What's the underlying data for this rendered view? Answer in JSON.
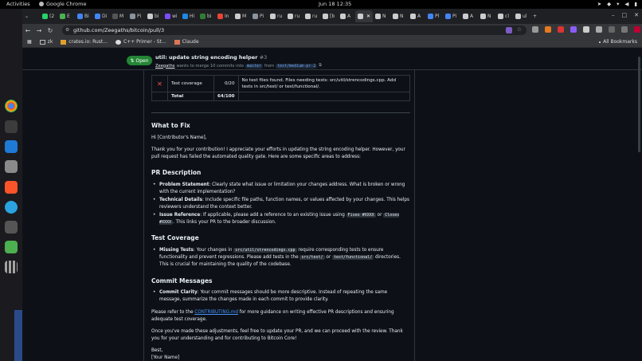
{
  "topbar": {
    "activities": "Activities",
    "app_name": "Google Chrome",
    "clock": "Jun 18  12:35"
  },
  "tabs": [
    {
      "label": "(2"
    },
    {
      "label": "E"
    },
    {
      "label": "Bi"
    },
    {
      "label": "Di"
    },
    {
      "label": "M"
    },
    {
      "label": "Pi"
    },
    {
      "label": "bi"
    },
    {
      "label": "wi"
    },
    {
      "label": "Hi"
    },
    {
      "label": "bi"
    },
    {
      "label": "In"
    },
    {
      "label": "M"
    },
    {
      "label": "Pi"
    },
    {
      "label": "ru"
    },
    {
      "label": "ru"
    },
    {
      "label": "ru"
    },
    {
      "label": "[b"
    },
    {
      "label": "A"
    },
    {
      "label": "",
      "active": true
    },
    {
      "label": "N"
    },
    {
      "label": "N"
    },
    {
      "label": "A"
    },
    {
      "label": "Pl"
    },
    {
      "label": "Pi"
    },
    {
      "label": "A"
    },
    {
      "label": "N"
    },
    {
      "label": "cl"
    },
    {
      "label": "ul"
    }
  ],
  "toolbar": {
    "url": "github.com/Zeegaths/bitcoin/pull/3"
  },
  "bookmarks": {
    "items": [
      "zk",
      "crates.io: Rust...",
      "C++ Primer - St...",
      "Claude"
    ],
    "all": "All Bookmarks"
  },
  "pr": {
    "status": "Open",
    "title": "util: update string encoding helper",
    "number": "#3",
    "author": "Zeegaths",
    "merge_text": "wants to merge 10 commits into",
    "base": "master",
    "from": "from",
    "head": "test/medium-pr-2"
  },
  "table": {
    "row_label": "Test coverage",
    "row_score": "0/20",
    "row_note": "No test files found. Files needing tests: src/util/strencodings.cpp. Add tests in src/test/ or test/functional/.",
    "total_label": "Total",
    "total_score": "64/100"
  },
  "body": {
    "what_to_fix": "What to Fix",
    "greeting": "Hi [Contributor's Name],",
    "intro": "Thank you for your contribution! I appreciate your efforts in updating the string encoding helper. However, your pull request has failed the automated quality gate. Here are some specific areas to address:",
    "pr_description_heading": "PR Description",
    "ps_label": "Problem Statement",
    "ps_text": ": Clearly state what issue or limitation your changes address. What is broken or wrong with the current implementation?",
    "td_label": "Technical Details",
    "td_text": ": Include specific file paths, function names, or values affected by your changes. This helps reviewers understand the context better.",
    "ir_label": "Issue Reference",
    "ir_text1": ": If applicable, please add a reference to an existing issue using",
    "ir_code1": "Fixes #XXXX",
    "ir_or": "or",
    "ir_code2": "Closes #XXXX",
    "ir_text2": ". This links your PR to the broader discussion.",
    "test_coverage_heading": "Test Coverage",
    "mt_label": "Missing Tests",
    "mt_text1": ": Your changes in",
    "mt_code1": "src/util/strencodings.cpp",
    "mt_text2": "require corresponding tests to ensure functionality and prevent regressions. Please add tests in the",
    "mt_code2": "src/test/",
    "mt_or": "or",
    "mt_code3": "test/functional/",
    "mt_text3": "directories. This is crucial for maintaining the quality of the codebase.",
    "commit_heading": "Commit Messages",
    "cc_label": "Commit Clarity",
    "cc_text": ": Your commit messages should be more descriptive. Instead of repeating the same message, summarize the changes made in each commit to provide clarity.",
    "refer_text1": "Please refer to the",
    "refer_link": "CONTRIBUTING.md",
    "refer_text2": "for more guidance on writing effective PR descriptions and ensuring adequate test coverage.",
    "closing": "Once you've made these adjustments, feel free to update your PR, and we can proceed with the review. Thank you for your understanding and for contributing to Bitcoin Core!",
    "best": "Best,",
    "signature": "[Your Name]"
  },
  "colors": {
    "open_badge": "#238636",
    "link": "#4493f8",
    "fail": "#f85149"
  }
}
